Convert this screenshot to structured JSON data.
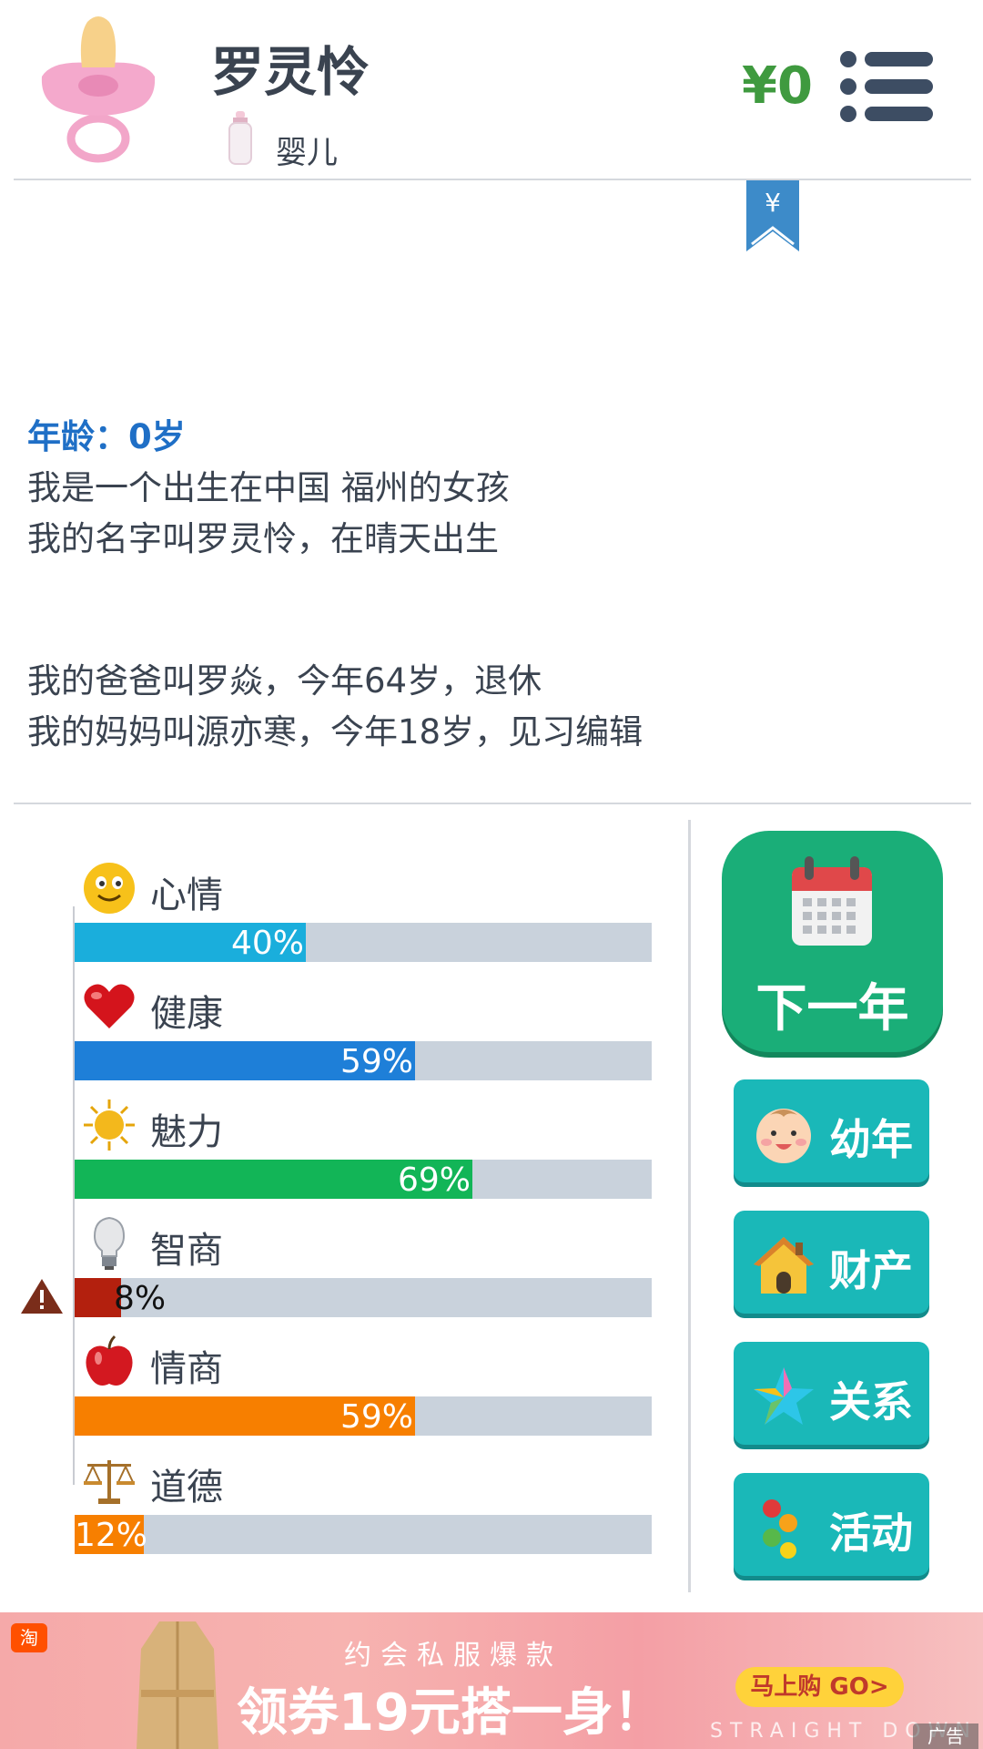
{
  "header": {
    "name": "罗灵怜",
    "stage": "婴儿",
    "money": "¥0"
  },
  "story": {
    "age_line": "年龄：0岁",
    "lines": [
      "我是一个出生在中国 福州的女孩",
      "我的名字叫罗灵怜，在晴天出生",
      "",
      "我的爸爸叫罗焱，今年64岁，退休",
      "我的妈妈叫源亦寒，今年18岁，见习编辑"
    ]
  },
  "stats": [
    {
      "label": "心情",
      "text": "40%",
      "value": 40,
      "color": "#1aaedc",
      "icon": "smile-icon"
    },
    {
      "label": "健康",
      "text": "59%",
      "value": 59,
      "color": "#1e7fd8",
      "icon": "heart-icon"
    },
    {
      "label": "魅力",
      "text": "69%",
      "value": 69,
      "color": "#12b557",
      "icon": "sun-icon"
    },
    {
      "label": "智商",
      "text": "8%",
      "value": 8,
      "color": "#b3200e",
      "icon": "lightbulb-icon",
      "warning": true
    },
    {
      "label": "情商",
      "text": "59%",
      "value": 59,
      "color": "#f77f00",
      "icon": "apple-icon"
    },
    {
      "label": "道德",
      "text": "12%",
      "value": 12,
      "color": "#f77f00",
      "icon": "scale-icon"
    }
  ],
  "actions": {
    "next_year": "下一年",
    "childhood": "幼年",
    "property": "财产",
    "relations": "关系",
    "activities": "活动"
  },
  "ad": {
    "badge": "淘",
    "subtitle": "约会私服爆款",
    "headline": "领券19元搭一身！",
    "cta": "马上购 GO>",
    "english": "STRAIGHT DOWN",
    "tag": "广告"
  }
}
